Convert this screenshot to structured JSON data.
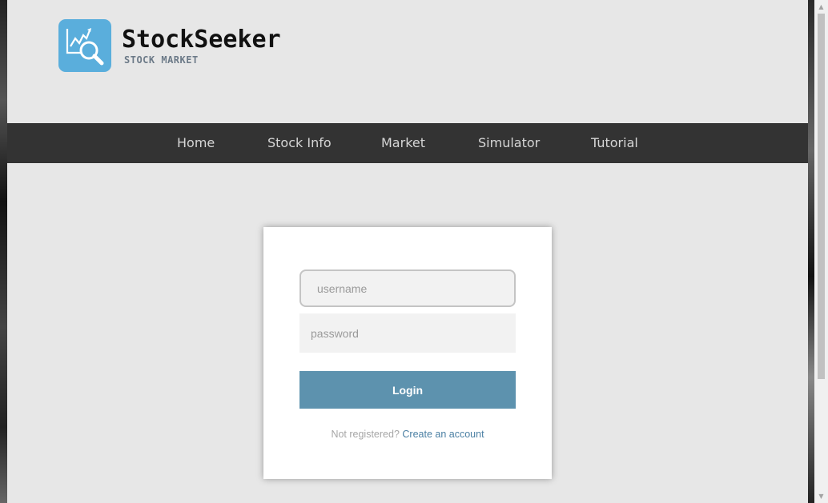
{
  "brand": {
    "name": "StockSeeker",
    "tagline": "STOCK MARKET",
    "logo_icon": "chart-magnifier-icon",
    "logo_color": "#5aaedc"
  },
  "nav": {
    "items": [
      {
        "label": "Home"
      },
      {
        "label": "Stock Info"
      },
      {
        "label": "Market"
      },
      {
        "label": "Simulator"
      },
      {
        "label": "Tutorial"
      }
    ],
    "background": "#333333"
  },
  "login": {
    "username_placeholder": "username",
    "password_placeholder": "password",
    "button_label": "Login",
    "button_color": "#5d92ae",
    "register_prompt": "Not registered?",
    "register_link": "Create an account"
  },
  "scrollbar": {
    "up_icon": "scroll-up-arrow-icon",
    "down_icon": "scroll-down-arrow-icon"
  }
}
